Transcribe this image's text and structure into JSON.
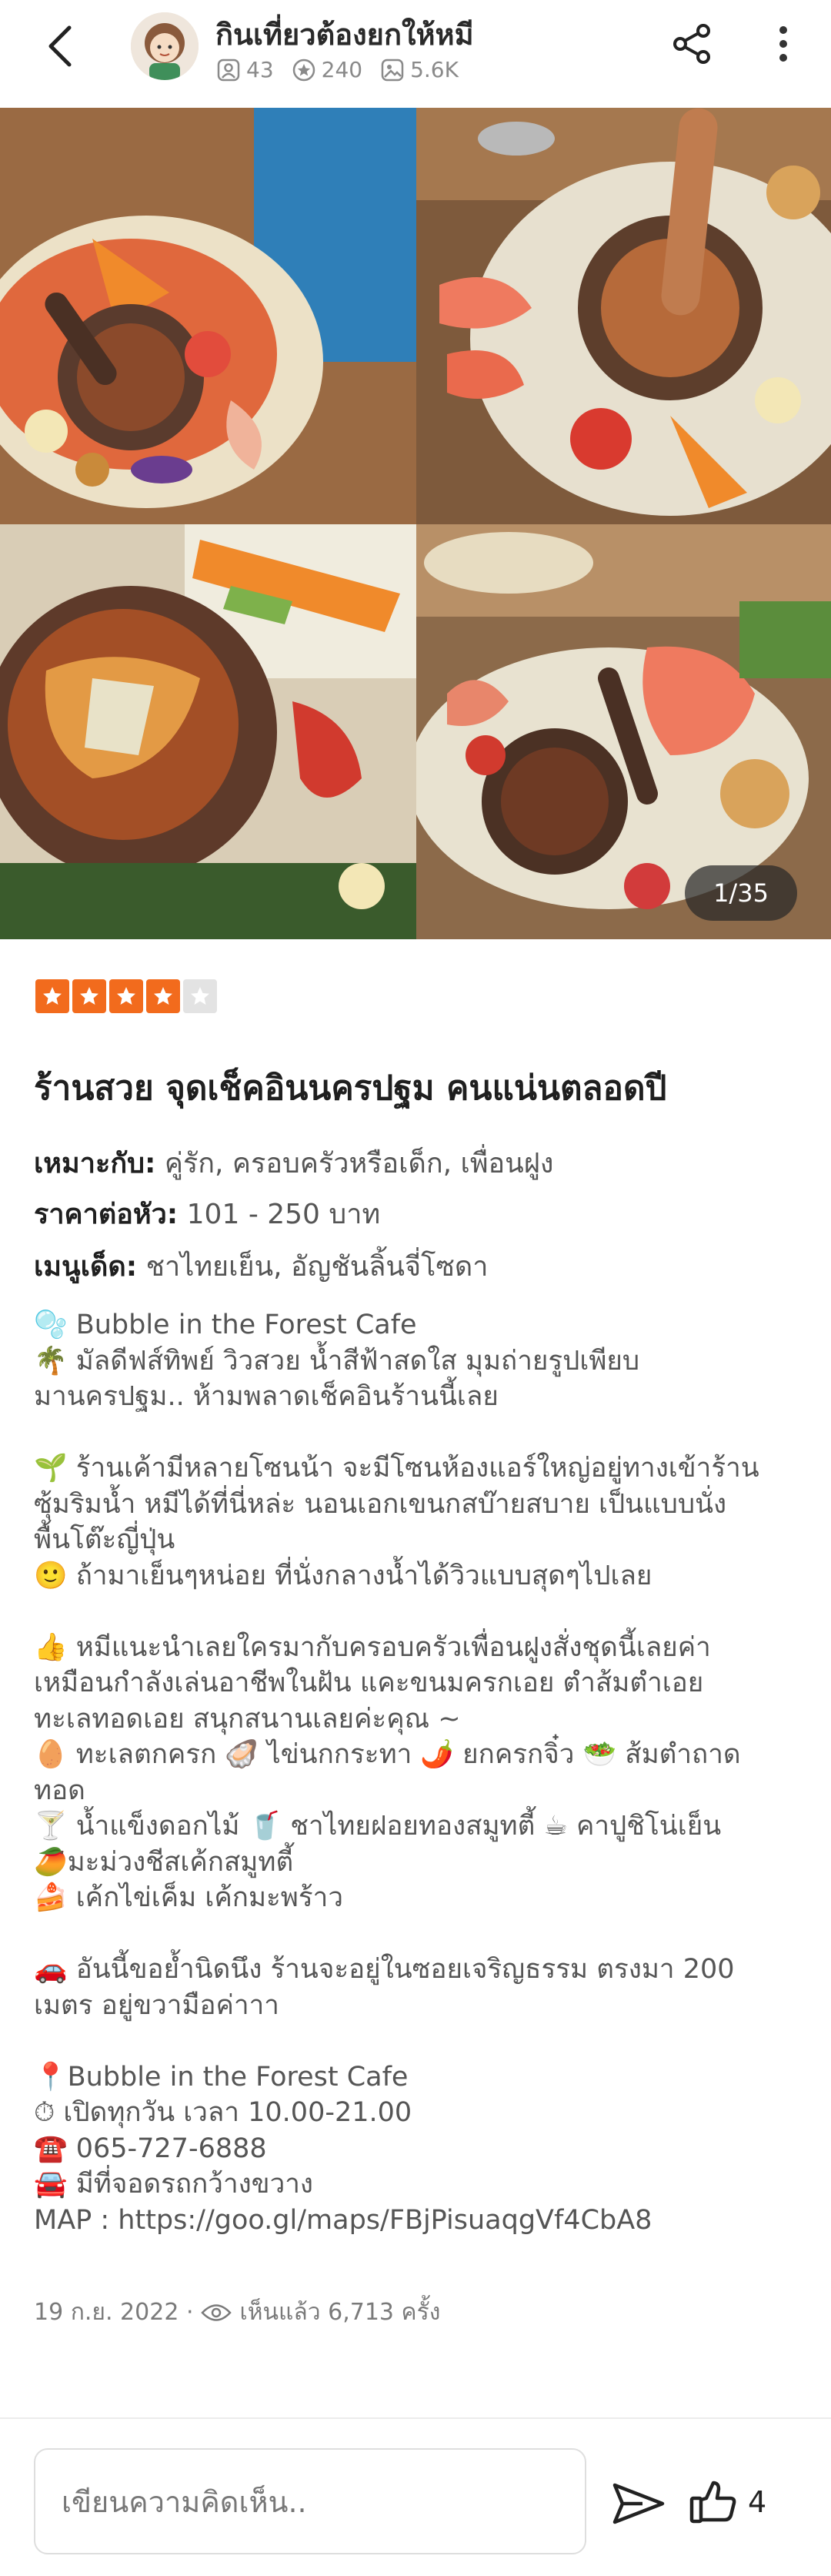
{
  "header": {
    "author_name": "กินเที่ยวต้องยกให้หมี",
    "followers": "43",
    "reviews": "240",
    "photos": "5.6K"
  },
  "gallery": {
    "counter": "1/35"
  },
  "rating": {
    "stars": 4,
    "max": 5,
    "color": "#f26b1d"
  },
  "post": {
    "title": "ร้านสวย จุดเช็คอินนครปฐม คนแน่นตลอดปี",
    "suitable_label": "เหมาะกับ:",
    "suitable_value": "คู่รัก, ครอบครัวหรือเด็ก, เพื่อนฝูง",
    "price_label": "ราคาต่อหัว:",
    "price_value": "101 - 250 บาท",
    "menu_label": "เมนูเด็ด:",
    "menu_value": "ชาไทยเย็น, อัญชันลิ้นจี่โซดา",
    "body": "🫧 Bubble in the Forest Cafe\n🌴 มัลดีฟส์ทิพย์ วิวสวย น้ำสีฟ้าสดใส มุมถ่ายรูปเพียบ\nมานครปฐม.. ห้ามพลาดเช็คอินร้านนี้เลย\n\n🌱 ร้านเค้ามีหลายโซนน้า จะมีโซนห้องแอร์ใหญ่อยู่ทางเข้าร้าน\nซุ้มริมน้ำ หมีได้ที่นี่หล่ะ นอนเอกเขนกสบ๊ายสบาย เป็นแบบนั่ง\nพื้นโต๊ะญี่ปุ่น\n🙂 ถ้ามาเย็นๆหน่อย ที่นั่งกลางน้ำได้วิวแบบสุดๆไปเลย\n\n👍 หมีแนะนำเลยใครมากับครอบครัวเพื่อนฝูงสั่งชุดนี้เลยค่า\nเหมือนกำลังเล่นอาชีพในฝัน แคะขนมครกเอย ตำส้มตำเอย\nทะเลทอดเอย สนุกสนานเลยค่ะคุณ ~\n🥚 ทะเลตกครก 🦪 ไข่นกกระทา 🌶️ ยกครกจิ๋ว 🥗 ส้มตำถาด\nทอด\n🍸 น้ำแข็งดอกไม้ 🥤 ชาไทยฝอยทองสมูทตี้ ☕ คาปูชิโน่เย็น\n🥭มะม่วงชีสเค้กสมูทตี้\n🍰 เค้กไข่เค็ม เค้กมะพร้าว\n\n🚗 อันนี้ขอย้ำนิดนึง ร้านจะอยู่ในซอยเจริญธรรม ตรงมา 200\nเมตร อยู่ขวามือค่าาา\n\n📍Bubble in the Forest Cafe\n⏱ เปิดทุกวัน เวลา 10.00-21.00\n☎️ 065-727-6888\n🚘 มีที่จอดรถกว้างขวาง\nMAP : https://goo.gl/maps/FBjPisuaqgVf4CbA8",
    "date": "19 ก.ย. 2022 ·",
    "views": "เห็นแล้ว 6,713 ครั้ง"
  },
  "bottom": {
    "comment_placeholder": "เขียนความคิดเห็น..",
    "like_count": "4"
  }
}
